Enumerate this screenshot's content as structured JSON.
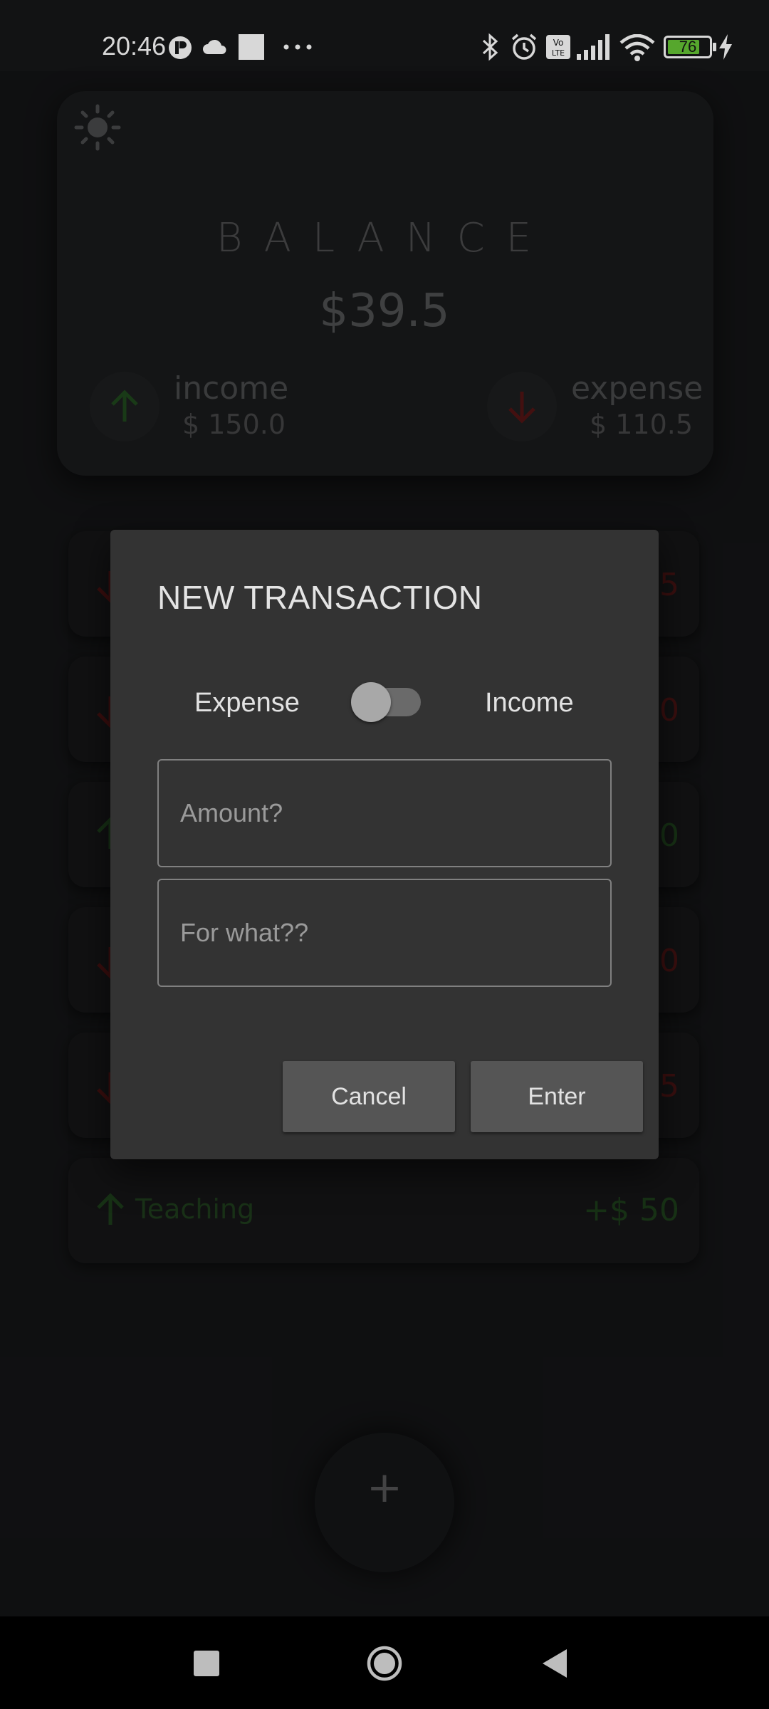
{
  "status_bar": {
    "time": "20:46",
    "icons": [
      "app-notification-icon",
      "cloud-icon",
      "square-notification-icon",
      "more-dots-icon",
      "bluetooth-icon",
      "alarm-icon",
      "volte-icon",
      "signal-icon",
      "wifi-icon",
      "battery-icon",
      "charging-icon"
    ],
    "battery_level": "76",
    "more_dots": "···"
  },
  "balance_card": {
    "label": "BALANCE",
    "balance": "$39.5",
    "income_label": "income",
    "income_value": "$ 150.0",
    "expense_label": "expense",
    "expense_value": "$ 110.5",
    "theme_icon": "sun-icon"
  },
  "transactions": {
    "rows": [
      {
        "type": "expense",
        "amount_tail": "5"
      },
      {
        "type": "expense",
        "amount_tail": "0"
      },
      {
        "type": "income",
        "amount_tail": "0"
      },
      {
        "type": "expense",
        "amount_tail": "0"
      },
      {
        "type": "expense",
        "amount_tail": "5"
      },
      {
        "type": "income",
        "title": "Teaching",
        "amount": "+$ 50"
      }
    ]
  },
  "fab": {
    "label": "+"
  },
  "dialog": {
    "title": "NEW TRANSACTION",
    "toggle_left_label": "Expense",
    "toggle_right_label": "Income",
    "toggle_on": false,
    "amount_placeholder": "Amount?",
    "purpose_placeholder": "For what??",
    "cancel_label": "Cancel",
    "enter_label": "Enter"
  },
  "colors": {
    "income_green": "#2e7d32",
    "expense_red": "#8e1b1b",
    "dialog_bg": "#333333",
    "button_bg": "#555555"
  },
  "nav_bar": {
    "icons": [
      "recents-square-icon",
      "home-circle-icon",
      "back-triangle-icon"
    ]
  }
}
